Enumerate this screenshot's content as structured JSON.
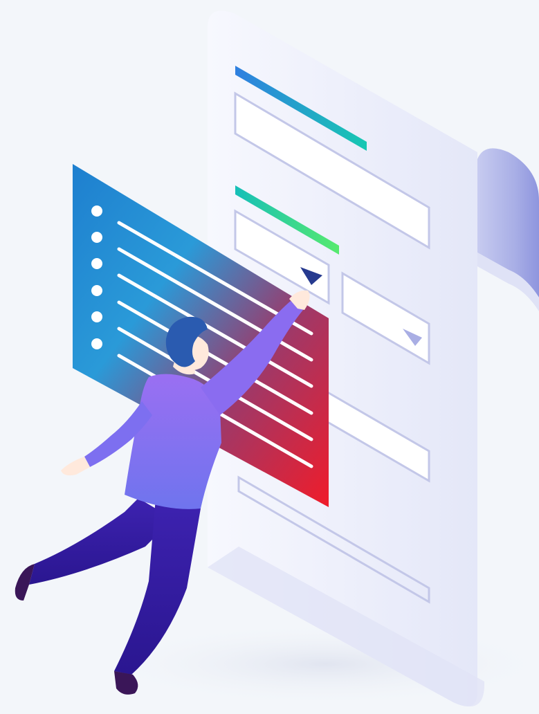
{
  "illustration": {
    "subject": "person-selecting-dropdown-on-form",
    "colors": {
      "background": "#f3f6fa",
      "paper": "#eef0fb",
      "paper_shade": "#c9cdf0",
      "field_border": "#c3c7e8",
      "accent_blue": "#2f86e0",
      "accent_teal": "#17c3b5",
      "accent_green": "#4ee27a",
      "panel_blue": "#1f8fd6",
      "panel_red": "#ee2233",
      "shirt": "#8a6cf0",
      "pants": "#3a1fa8",
      "hair": "#2a5bb0",
      "skin": "#ffe9dc",
      "arrow_dark": "#263a8f",
      "arrow_light": "#a9aee4"
    },
    "icons": [
      "dropdown-arrow-icon",
      "list-bullet-icon"
    ]
  }
}
